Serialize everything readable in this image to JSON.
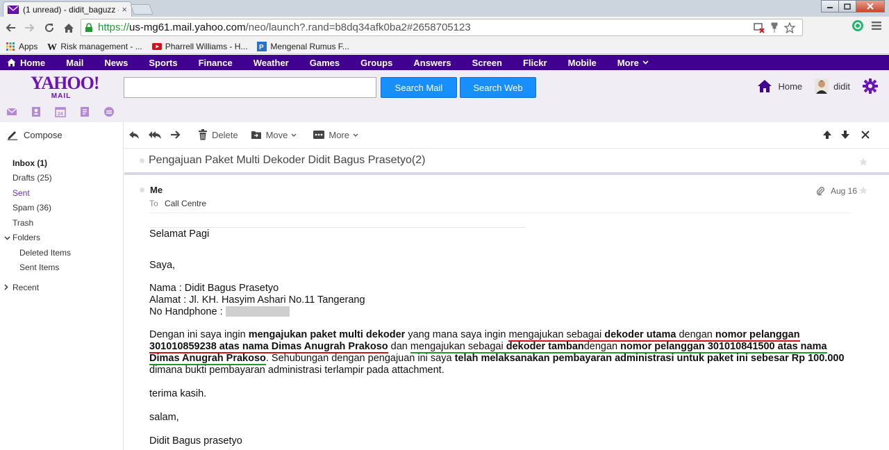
{
  "browser": {
    "tab_title": "(1 unread) - didit_baguzz -",
    "tab_close": "×",
    "url_scheme": "https://",
    "url_host": "us-mg61.mail.yahoo.com",
    "url_path": "/neo/launch?.rand=b8dq34afk0ba2#2658705123",
    "bookmarks": [
      {
        "label": "Apps",
        "icon": "apps-grid-icon"
      },
      {
        "label": "Risk management - ...",
        "icon": "wikipedia-icon"
      },
      {
        "label": "Pharrell Williams - H...",
        "icon": "youtube-icon"
      },
      {
        "label": "Mengenal Rumus F...",
        "icon": "site-icon"
      }
    ]
  },
  "yahoo_bar": {
    "items": [
      "Home",
      "Mail",
      "News",
      "Sports",
      "Finance",
      "Weather",
      "Games",
      "Groups",
      "Answers",
      "Screen",
      "Flickr",
      "Mobile",
      "More"
    ]
  },
  "header": {
    "logo_main": "YAHOO!",
    "logo_sub": "MAIL",
    "search_placeholder": "",
    "search_mail_label": "Search Mail",
    "search_web_label": "Search Web",
    "home_label": "Home",
    "user_name": "didit"
  },
  "sidebar": {
    "compose_label": "Compose",
    "items": [
      {
        "label": "Inbox (1)",
        "style": "bold"
      },
      {
        "label": "Drafts (25)",
        "style": "normal"
      },
      {
        "label": "Sent",
        "style": "purple"
      },
      {
        "label": "Spam (36)",
        "style": "normal"
      },
      {
        "label": "Trash",
        "style": "normal"
      },
      {
        "label": "Folders",
        "style": "expander-open"
      },
      {
        "label": "Deleted Items",
        "style": "sub"
      },
      {
        "label": "Sent Items",
        "style": "sub"
      },
      {
        "label": "Recent",
        "style": "expander-closed"
      }
    ]
  },
  "message_toolbar": {
    "delete_label": "Delete",
    "move_label": "Move",
    "more_label": "More"
  },
  "conversation": {
    "subject": "Pengajuan Paket Multi Dekoder Didit Bagus Prasetyo(2)"
  },
  "message": {
    "from": "Me",
    "to_label": "To",
    "to": "Call Centre",
    "date": "Aug 16",
    "greeting": "Selamat Pagi",
    "saya": "Saya,",
    "nama": "Nama : Didit Bagus Prasetyo",
    "alamat": "Alamat : Jl. KH. Hasyim Ashari No.11 Tangerang",
    "handphone_label": "No Handphone :",
    "p1": "Dengan ini saya ingin ",
    "p1_b1": "mengajukan paket multi dekoder",
    "p1_2": " yang mana saya ingin ",
    "p1_u1": "mengajukan sebagai ",
    "p1_b2": "dekoder utama",
    "p1_3": " dengan ",
    "p1_b3a": "nomor pelanggan",
    "p1_b3b": "301010859238 atas nama Dimas Anugrah Prakoso",
    "p1_4": " dan ",
    "p1_u2": "mengajukan sebagai ",
    "p1_b4": "dekoder tamban",
    "p1_5": "dengan ",
    "p1_b5a": "nomor pelanggan 301010841500 atas nama",
    "p1_b5b": "Dimas Anugrah Prakoso",
    "p1_6": ". Sehubungan dengan pengajuan ini saya ",
    "p1_b6": "telah melaksanakan pembayaran administrasi untuk paket ini sebesar Rp 100.000",
    "p1_7": " dimana bukti pembayaran administrasi terlampir pada attachment.",
    "thanks": "terima kasih.",
    "salam": "salam,",
    "signature": "Didit Bagus prasetyo"
  },
  "colors": {
    "yahoo_purple": "#400090",
    "brand_purple": "#6b13b6",
    "button_blue": "#188fff",
    "underline_red": "#d0121b",
    "underline_green": "#1f9a2a"
  }
}
